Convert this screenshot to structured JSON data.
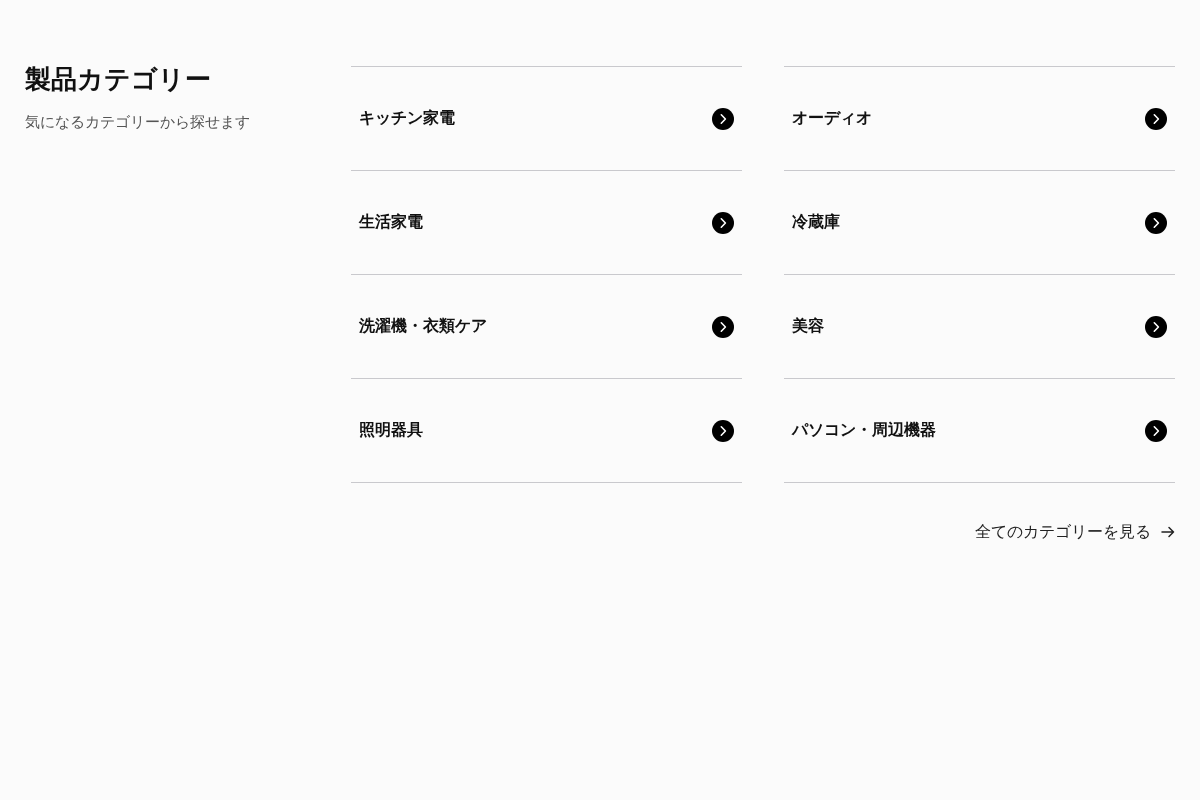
{
  "heading": {
    "title": "製品カテゴリー",
    "subtitle": "気になるカテゴリーから探せます"
  },
  "categories": [
    {
      "label": "キッチン家電"
    },
    {
      "label": "オーディオ"
    },
    {
      "label": "生活家電"
    },
    {
      "label": "冷蔵庫"
    },
    {
      "label": "洗濯機・衣類ケア"
    },
    {
      "label": "美容"
    },
    {
      "label": "照明器具"
    },
    {
      "label": "パソコン・周辺機器"
    }
  ],
  "view_all_link": "全てのカテゴリーを見る"
}
